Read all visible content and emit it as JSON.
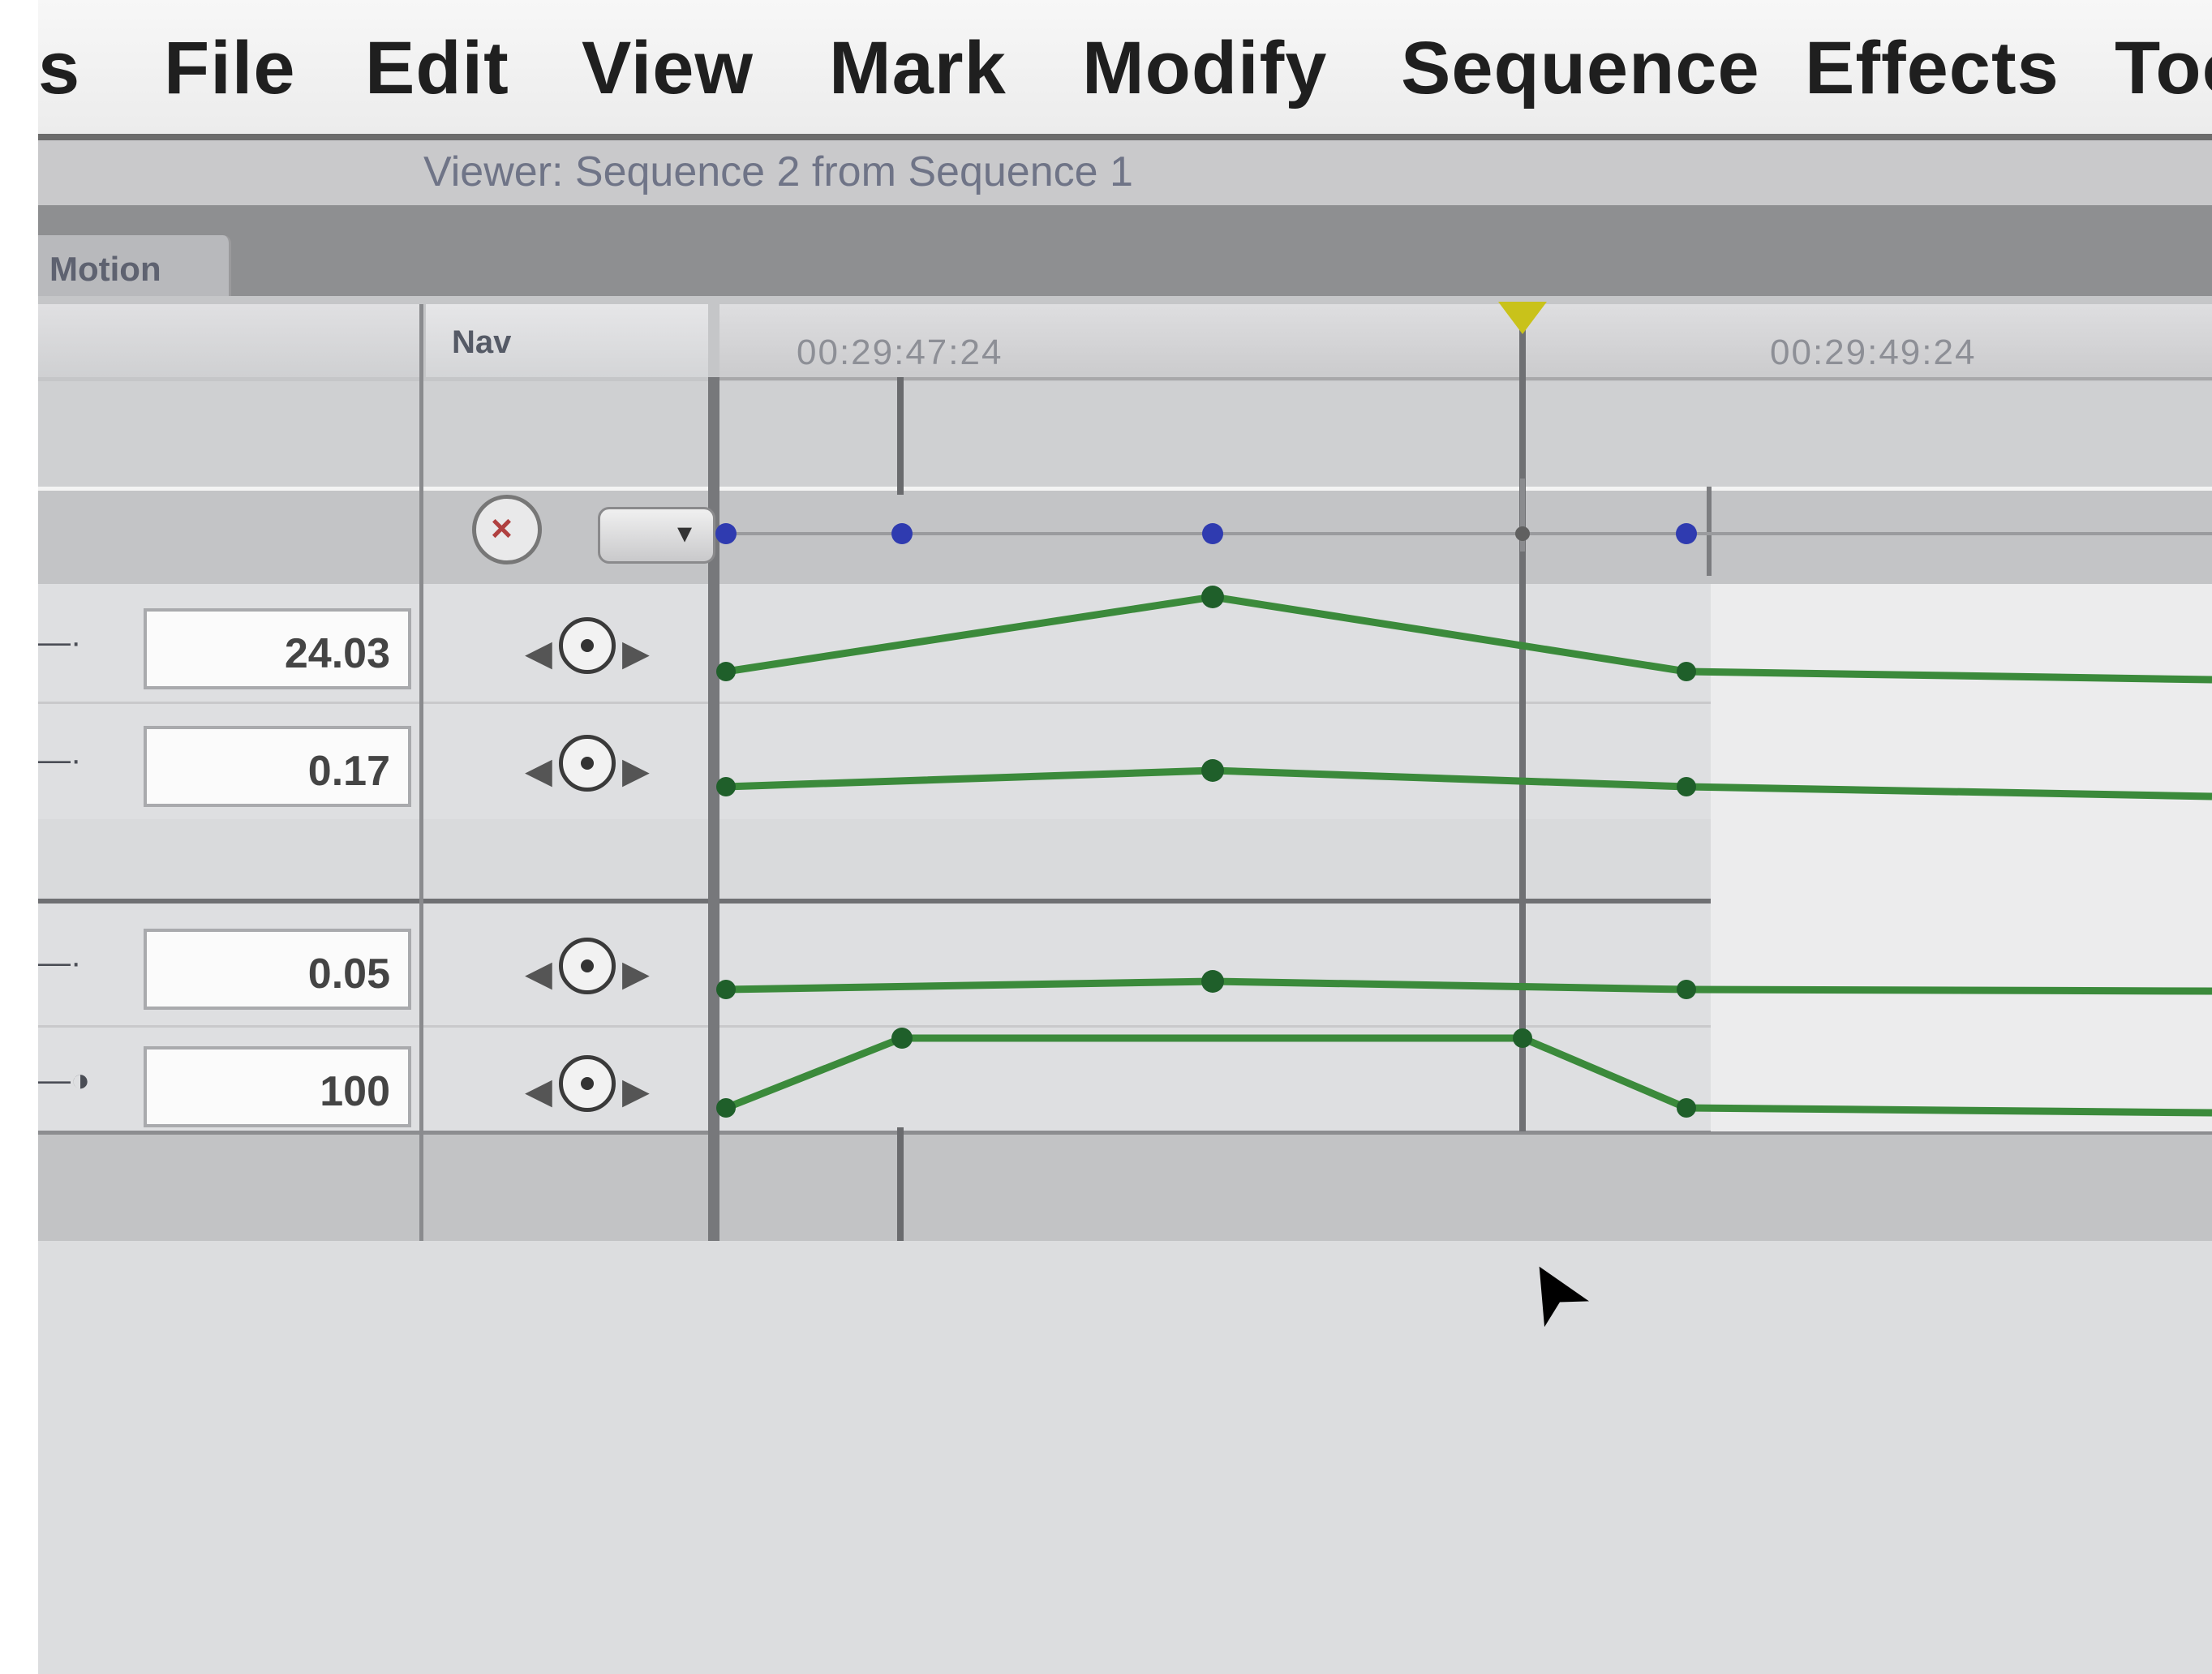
{
  "menubar": {
    "items": [
      "s",
      "File",
      "Edit",
      "View",
      "Mark",
      "Modify",
      "Sequence",
      "Effects",
      "Too"
    ]
  },
  "viewer": {
    "title": "Viewer: Sequence 2 from Sequence 1",
    "tab_label": "Motion"
  },
  "columns": {
    "nav_label": "Nav"
  },
  "ruler": {
    "timecodes": [
      "00:29:47:24",
      "00:29:49:24"
    ]
  },
  "parameters": [
    {
      "value": "24.03"
    },
    {
      "value": "0.17"
    },
    {
      "value": "0.05"
    },
    {
      "value": "100"
    }
  ],
  "icons": {
    "reset": "reset-x-icon",
    "keyframe_nav": "keyframe-nav-icon",
    "cursor": "mouse-pointer-icon",
    "playhead": "playhead-icon"
  },
  "colors": {
    "curve": "#3b8a3b",
    "keyframe_blue": "#2f3bb0",
    "playhead": "#c9c21a"
  }
}
